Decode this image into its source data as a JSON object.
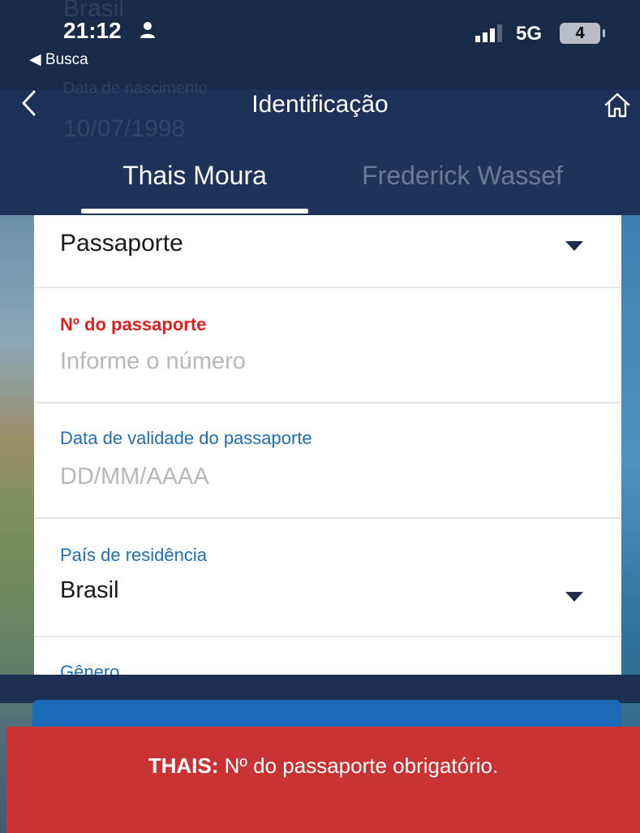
{
  "status_bar": {
    "time": "21:12",
    "back_app": "◀ Busca",
    "network": "5G",
    "battery": "4"
  },
  "background_ghost": {
    "country": "Brasil",
    "birth_label": "Data de nascimento",
    "birth_value": "10/07/1998"
  },
  "nav": {
    "title": "Identificação"
  },
  "tabs": [
    {
      "label": "Thais Moura",
      "active": true
    },
    {
      "label": "Frederick Wassef",
      "active": false
    }
  ],
  "form": {
    "document_type": "Passaporte",
    "passport_number": {
      "label": "Nº do passaporte",
      "placeholder": "Informe o número"
    },
    "passport_validity": {
      "label": "Data de validade do passaporte",
      "placeholder": "DD/MM/AAAA"
    },
    "residence_country": {
      "label": "País de residência",
      "value": "Brasil"
    },
    "gender": {
      "label": "Gênero"
    }
  },
  "error": {
    "name": "THAIS:",
    "message": " Nº do passaporte obrigatório."
  },
  "colors": {
    "header_bg": "#172a48",
    "label_blue": "#1f6fb2",
    "error_red": "#e02020",
    "banner_red": "#c83232",
    "button_blue": "#1a6ab8"
  }
}
